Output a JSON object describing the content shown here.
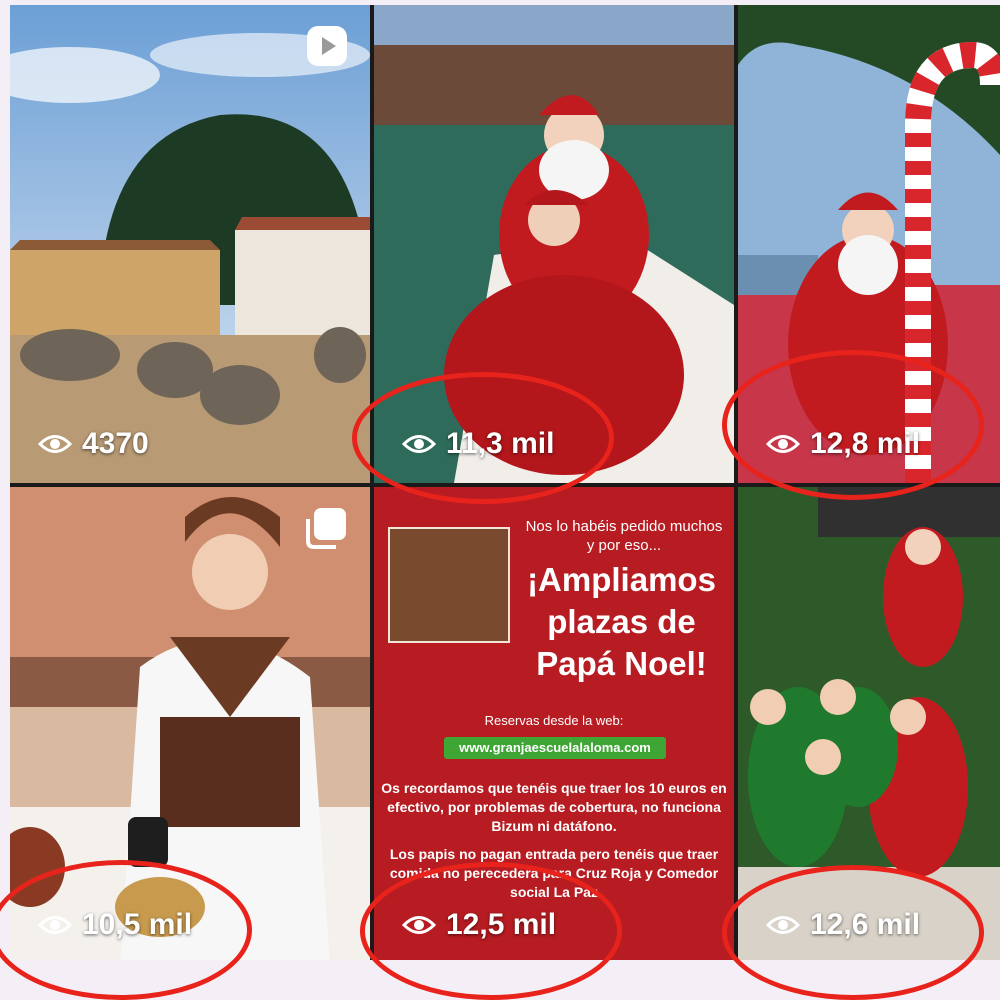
{
  "grid": {
    "tiles": [
      {
        "views": "4370",
        "media": "reel"
      },
      {
        "views": "11,3 mil",
        "media": "photo"
      },
      {
        "views": "12,8 mil",
        "media": "photo"
      },
      {
        "views": "10,5 mil",
        "media": "carousel"
      },
      {
        "views": "12,5 mil",
        "media": "photo"
      },
      {
        "views": "12,6 mil",
        "media": "photo"
      }
    ]
  },
  "poster": {
    "intro": "Nos lo habéis pedido muchos y por eso...",
    "headline_1": "¡Ampliamos",
    "headline_2": "plazas de",
    "headline_3": "Papá Noel!",
    "reservas": "Reservas desde la web:",
    "website": "www.granjaescuelalaloma.com",
    "paragraph_1": "Os recordamos que tenéis que traer los 10 euros en efectivo, por problemas de cobertura, no funciona Bizum ni datáfono.",
    "paragraph_2": "Los papis no pagan entrada pero tenéis que traer comida no perecedera para Cruz Roja y Comedor social La Paz"
  },
  "colors": {
    "highlight_ring": "#e8231c",
    "poster_bg": "#b71c22",
    "web_pill": "#3fa535"
  },
  "icons": {
    "views": "eye-icon",
    "reel": "reel-icon",
    "carousel": "carousel-icon"
  }
}
